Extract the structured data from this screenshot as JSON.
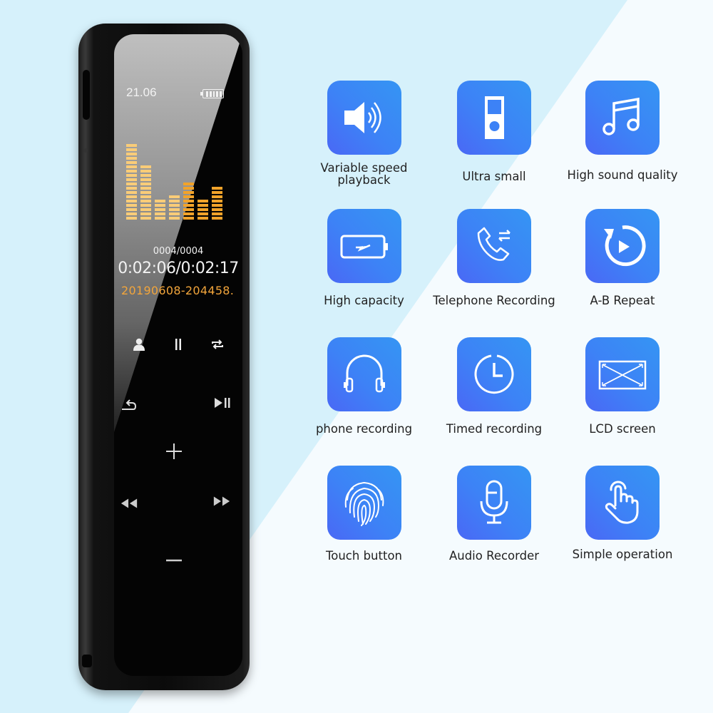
{
  "device": {
    "screen": {
      "clock": "21.06",
      "battery_level_bars": 5,
      "equalizer_levels": [
        18,
        13,
        5,
        6,
        9,
        5,
        8
      ],
      "track_counter": "0004/0004",
      "elapsed_total": "0:02:06/0:02:17",
      "filename": "20190608-204458."
    },
    "controls": {
      "contact": "contact-icon",
      "pause": "pause-icon",
      "repeat": "repeat-icon",
      "back": "back-icon",
      "play_pause": "play-pause-icon",
      "volume_up": "+",
      "rewind": "rewind-icon",
      "fast_forward": "fast-forward-icon",
      "volume_down": "−"
    }
  },
  "colors": {
    "tile_gradient_start": "#4a68f5",
    "tile_gradient_end": "#3595f3",
    "equalizer_light": "#f9cc78",
    "equalizer_dark": "#f2a32a",
    "filename_orange": "#f2a53b",
    "background_light_blue": "#d6f1fb"
  },
  "features": [
    {
      "label": "Variable speed\nplayback",
      "line1": "Variable speed",
      "line2": "playback",
      "icon": "speaker-icon"
    },
    {
      "label": "Ultra small",
      "icon": "mp3-player-icon"
    },
    {
      "label": "High sound quality",
      "icon": "music-note-icon"
    },
    {
      "label": "High capacity",
      "icon": "battery-charging-icon"
    },
    {
      "label": "Telephone Recording",
      "icon": "phone-transfer-icon"
    },
    {
      "label": "A-B Repeat",
      "icon": "replay-icon"
    },
    {
      "label": "phone recording",
      "icon": "headphones-icon"
    },
    {
      "label": "Timed recording",
      "icon": "clock-icon"
    },
    {
      "label": "LCD screen",
      "icon": "fullscreen-icon"
    },
    {
      "label": "Touch button",
      "icon": "fingerprint-icon"
    },
    {
      "label": "Audio Recorder",
      "icon": "microphone-icon"
    },
    {
      "label": "Simple operation",
      "icon": "tap-hand-icon"
    }
  ]
}
